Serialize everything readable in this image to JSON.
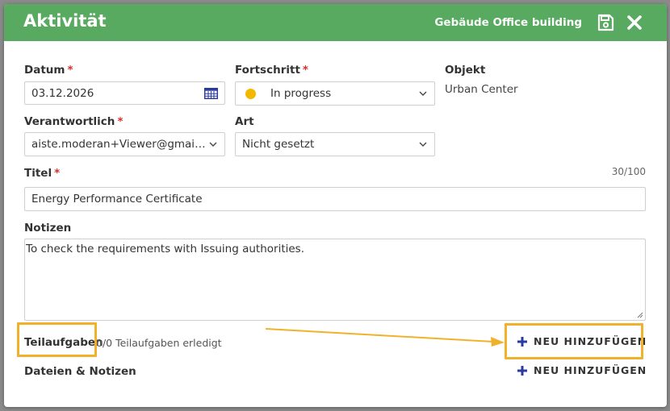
{
  "header": {
    "title": "Aktivität",
    "building_prefix": "Gebäude",
    "building_name": "Office building",
    "save_icon": "save-icon",
    "close_icon": "close-icon",
    "color": "#57aa5f"
  },
  "form": {
    "date": {
      "label": "Datum",
      "required": "*",
      "value": "03.12.2026"
    },
    "progress": {
      "label": "Fortschritt",
      "required": "*",
      "value": "In progress",
      "status_color": "#f5b800"
    },
    "object": {
      "label": "Objekt",
      "value": "Urban Center"
    },
    "responsible": {
      "label": "Verantwortlich",
      "required": "*",
      "value": "aiste.moderan+Viewer@gmail...."
    },
    "type": {
      "label": "Art",
      "value": "Nicht gesetzt"
    },
    "title": {
      "label": "Titel",
      "required": "*",
      "value": "Energy Performance Certificate",
      "counter": "30/100"
    },
    "notes": {
      "label": "Notizen",
      "value": "To check the requirements with Issuing authorities."
    }
  },
  "subtasks": {
    "label": "Teilaufgaben",
    "info": "0/0 Teilaufgaben erledigt",
    "add_label": "NEU HINZUFÜGEN"
  },
  "files": {
    "label": "Dateien & Notizen",
    "add_label": "NEU HINZUFÜGEN"
  },
  "colors": {
    "accent_blue": "#2b3a9e",
    "highlight": "#f2b12b",
    "required": "#d32f2f"
  }
}
